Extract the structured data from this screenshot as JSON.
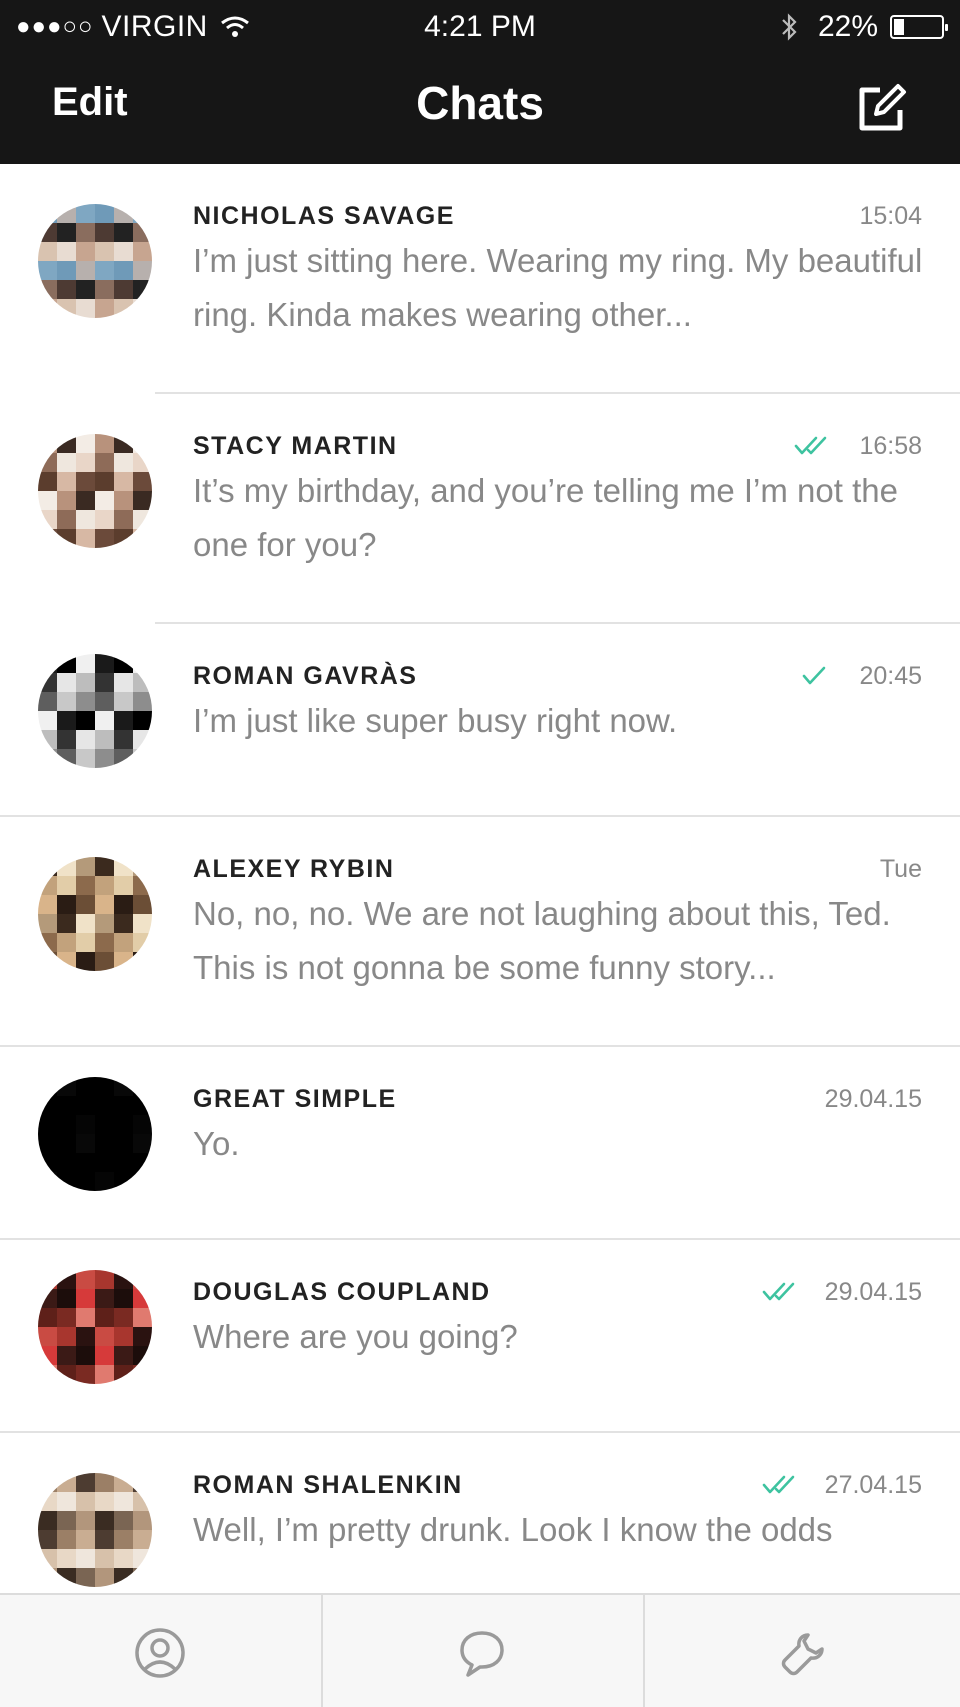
{
  "status_bar": {
    "signal": "●●●○○",
    "carrier": "VIRGIN",
    "time": "4:21 PM",
    "battery": "22%",
    "battery_level": 0.22,
    "icons": [
      "wifi-icon",
      "bluetooth-icon",
      "battery-icon"
    ]
  },
  "nav": {
    "edit_label": "Edit",
    "title": "Chats",
    "compose_icon": "compose-icon"
  },
  "chats": [
    {
      "name": "NICHOLAS SAVAGE",
      "time": "15:04",
      "status": "none",
      "message": "I’m just sitting here. Wearing my ring. My beautiful ring. Kinda makes wearing other..."
    },
    {
      "name": "STACY MARTIN",
      "time": "16:58",
      "status": "double-check",
      "message": "It’s my birthday, and you’re telling me I’m not the one for you?"
    },
    {
      "name": "ROMAN GAVRÀS",
      "time": "20:45",
      "status": "single-check",
      "message": "I’m just like super busy right now."
    },
    {
      "name": "ALEXEY RYBIN",
      "time": "Tue",
      "status": "none",
      "message": "No, no, no. We are not laughing about this, Ted. This is not gonna be some funny story..."
    },
    {
      "name": "GREAT SIMPLE",
      "time": "29.04.15",
      "status": "none",
      "message": "Yo."
    },
    {
      "name": "DOUGLAS COUPLAND",
      "time": "29.04.15",
      "status": "double-check",
      "message": "Where are you going?"
    },
    {
      "name": "ROMAN SHALENKIN",
      "time": "27.04.15",
      "status": "double-check",
      "message": "Well, I’m pretty drunk. Look I know the odds"
    }
  ],
  "tabs": [
    {
      "icon": "contacts-icon"
    },
    {
      "icon": "chat-bubble-icon"
    },
    {
      "icon": "settings-wrench-icon"
    }
  ],
  "colors": {
    "bar_background": "#161616",
    "check_green": "#3ec3a0",
    "name_text": "#222222",
    "message_text": "#888888"
  }
}
